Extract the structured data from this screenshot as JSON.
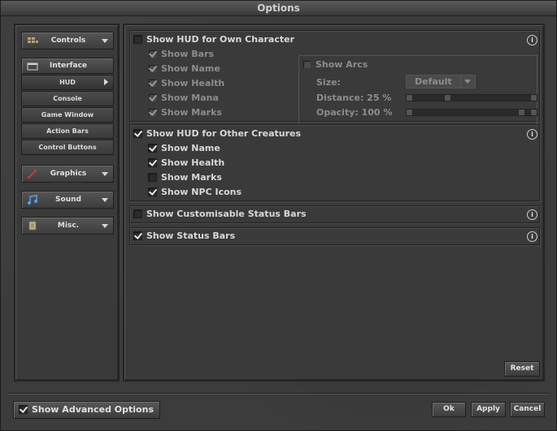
{
  "window": {
    "title": "Options"
  },
  "sidebar": {
    "categories": [
      {
        "label": "Controls"
      },
      {
        "label": "Interface"
      },
      {
        "label": "Graphics"
      },
      {
        "label": "Sound"
      },
      {
        "label": "Misc."
      }
    ],
    "interface_items": [
      "HUD",
      "Console",
      "Game Window",
      "Action Bars",
      "Control Buttons"
    ],
    "selected_item": "HUD"
  },
  "hud": {
    "own_character": {
      "label": "Show HUD for Own Character",
      "checked": false,
      "options": [
        {
          "label": "Show Bars",
          "checked": true
        },
        {
          "label": "Show Name",
          "checked": true
        },
        {
          "label": "Show Health",
          "checked": true
        },
        {
          "label": "Show Mana",
          "checked": true
        },
        {
          "label": "Show Marks",
          "checked": true
        }
      ],
      "arcs": {
        "label": "Show Arcs",
        "size_label": "Size:",
        "size_value": "Default",
        "distance_label": "Distance: 25 %",
        "distance_value": 25,
        "opacity_label": "Opacity: 100 %",
        "opacity_value": 100
      }
    },
    "other_creatures": {
      "label": "Show HUD for Other Creatures",
      "checked": true,
      "options": [
        {
          "label": "Show Name",
          "checked": true
        },
        {
          "label": "Show Health",
          "checked": true
        },
        {
          "label": "Show Marks",
          "checked": false
        },
        {
          "label": "Show NPC Icons",
          "checked": true
        }
      ]
    },
    "customisable_status_bars": {
      "label": "Show Customisable Status Bars",
      "checked": false
    },
    "status_bars": {
      "label": "Show Status Bars",
      "checked": true
    }
  },
  "buttons": {
    "reset": "Reset",
    "ok": "Ok",
    "apply": "Apply",
    "cancel": "Cancel",
    "advanced_label": "Show Advanced Options"
  },
  "colors": {
    "background": "#3c3c3c",
    "text": "#d8d8d8",
    "disabled_text": "#8d8d8d"
  }
}
